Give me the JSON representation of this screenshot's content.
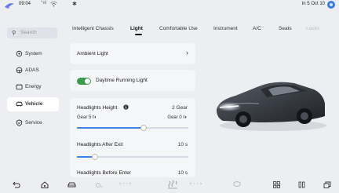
{
  "status": {
    "time": "09:04",
    "signal": "°ııl",
    "bluetooth": "✱",
    "right_text": "In 5 Oct 10"
  },
  "sidebar": {
    "search_placeholder": "Search",
    "items": [
      {
        "label": "System",
        "icon": "gear-icon"
      },
      {
        "label": "ADAS",
        "icon": "steering-wheel-icon"
      },
      {
        "label": "Energy",
        "icon": "battery-icon"
      },
      {
        "label": "Vehicle",
        "icon": "car-icon",
        "active": true
      },
      {
        "label": "Service",
        "icon": "shield-icon"
      }
    ]
  },
  "tabs": [
    {
      "label": "Intelligent Chassis"
    },
    {
      "label": "Light",
      "active": true
    },
    {
      "label": "Comfortable Use"
    },
    {
      "label": "Instrument"
    },
    {
      "label": "A/C"
    },
    {
      "label": "Seats"
    },
    {
      "label": "Locks",
      "disabled": true
    }
  ],
  "settings": {
    "ambient_light": "Ambient Light",
    "daytime_running_light": "Daytime Running Light",
    "daytime_running_on": true,
    "headlights_height": {
      "label": "Headlights Height",
      "value": "2 Gear",
      "min_label": "Gear 5",
      "max_label": "Gear 0",
      "fraction": 0.6
    },
    "headlights_after_exit": {
      "label": "Headlights After Exit",
      "value": "10 s",
      "fraction": 0.16
    },
    "headlights_before_enter": {
      "label": "Headlights Before Enter",
      "value": "10 s"
    }
  },
  "dock": {
    "back": "back-icon",
    "home": "home-icon",
    "car": "car-icon",
    "arrows_left": "‹   - -   ›",
    "arrows_right": "‹   - -   ›",
    "grid": "grid-icon",
    "pause": "pause-icon",
    "copy": "copy-icon"
  },
  "colors": {
    "accent": "#3b82e6",
    "toggle_on": "#3b9a4c",
    "background": "#eceef2"
  }
}
